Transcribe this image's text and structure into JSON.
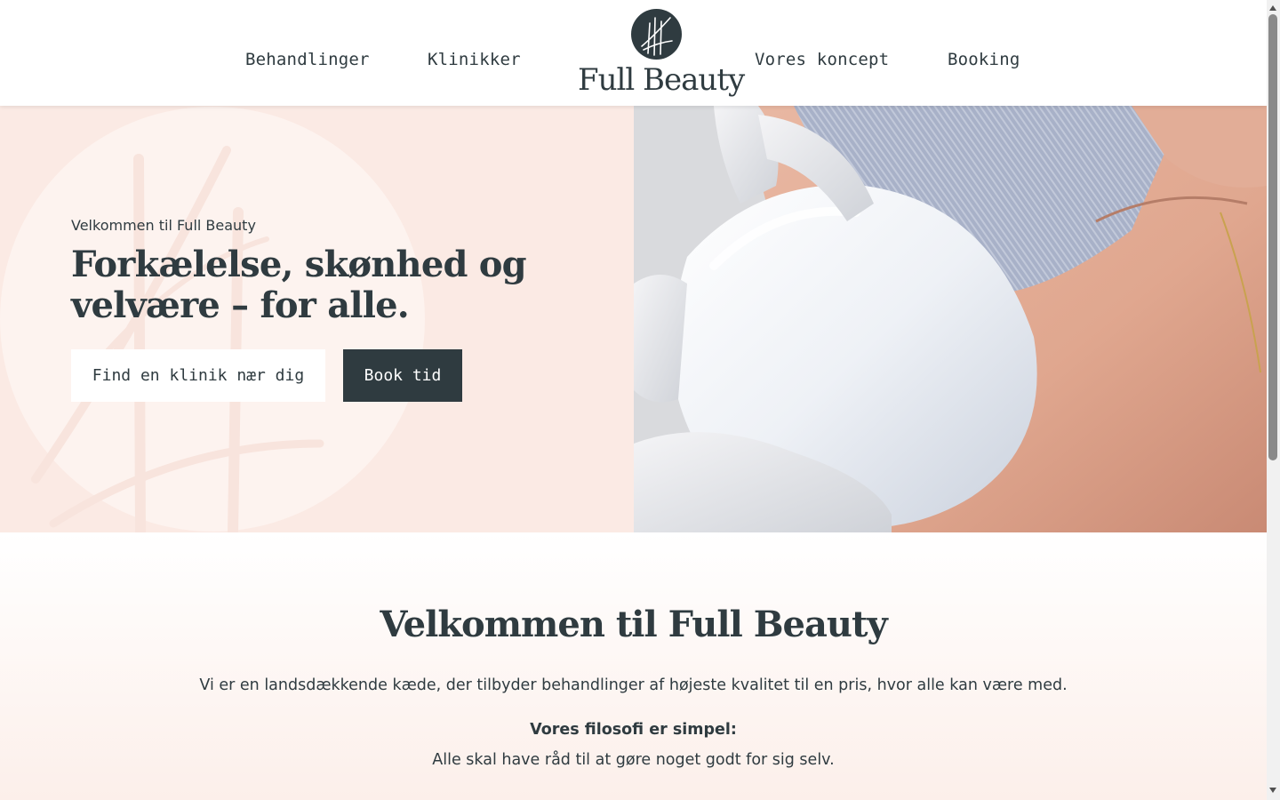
{
  "header": {
    "nav_left": [
      "Behandlinger",
      "Klinikker"
    ],
    "nav_right": [
      "Vores koncept",
      "Booking"
    ],
    "logo_text": "Full Beauty"
  },
  "hero": {
    "eyebrow": "Velkommen til Full Beauty",
    "title_line1": "Forkælelse, skønhed og",
    "title_line2": "velvære – for alle.",
    "btn_find": "Find en klinik nær dig",
    "btn_book": "Book tid"
  },
  "intro": {
    "title": "Velkommen til Full Beauty",
    "p1": "Vi er en landsdækkende kæde, der tilbyder behandlinger af højeste kvalitet til en pris, hvor alle kan være med.",
    "p2": "Vores filosofi er simpel:",
    "p3": "Alle skal have råd til at gøre noget godt for sig selv."
  },
  "colors": {
    "primary_dark": "#2f3b40",
    "hero_bg": "#fbeae4",
    "intro_gradient_end": "#fcefea"
  },
  "icons": {
    "logo_mark": "wheat-stalks-logo-icon"
  }
}
